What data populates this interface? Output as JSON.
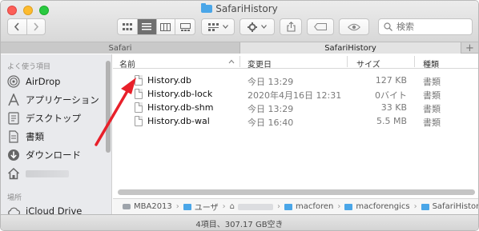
{
  "window": {
    "title": "SafariHistory"
  },
  "toolbar": {
    "back_icon": "chevron-left-icon",
    "forward_icon": "chevron-right-icon",
    "search_placeholder": "検索"
  },
  "tabs": [
    {
      "label": "Safari"
    },
    {
      "label": "SafariHistory"
    }
  ],
  "sidebar": {
    "favorites_heading": "よく使う項目",
    "items": [
      {
        "label": "AirDrop",
        "icon": "airdrop-icon"
      },
      {
        "label": "アプリケーション",
        "icon": "applications-icon"
      },
      {
        "label": "デスクトップ",
        "icon": "desktop-icon"
      },
      {
        "label": "書類",
        "icon": "documents-icon"
      },
      {
        "label": "ダウンロード",
        "icon": "downloads-icon"
      },
      {
        "label": "",
        "icon": "home-icon"
      }
    ],
    "places_heading": "場所",
    "places": [
      {
        "label": "iCloud Drive",
        "icon": "icloud-icon"
      }
    ]
  },
  "columns": {
    "name": "名前",
    "date": "変更日",
    "size": "サイズ",
    "kind": "種類"
  },
  "files": [
    {
      "name": "History.db",
      "date": "今日 13:29",
      "size": "127 KB",
      "kind": "書類"
    },
    {
      "name": "History.db-lock",
      "date": "2020年4月16日 12:31",
      "size": "0バイト",
      "kind": "書類"
    },
    {
      "name": "History.db-shm",
      "date": "今日 13:29",
      "size": "33 KB",
      "kind": "書類"
    },
    {
      "name": "History.db-wal",
      "date": "今日 16:40",
      "size": "5.5 MB",
      "kind": "書類"
    }
  ],
  "pathbar": {
    "disk": "MBA2013",
    "users": "ユーザ",
    "folder1": "macforen",
    "folder2": "macforengics",
    "folder3": "SafariHistory"
  },
  "status": {
    "text": "4項目、307.17 GB空き"
  },
  "annotation": {
    "arrow_color": "#e8202a"
  }
}
